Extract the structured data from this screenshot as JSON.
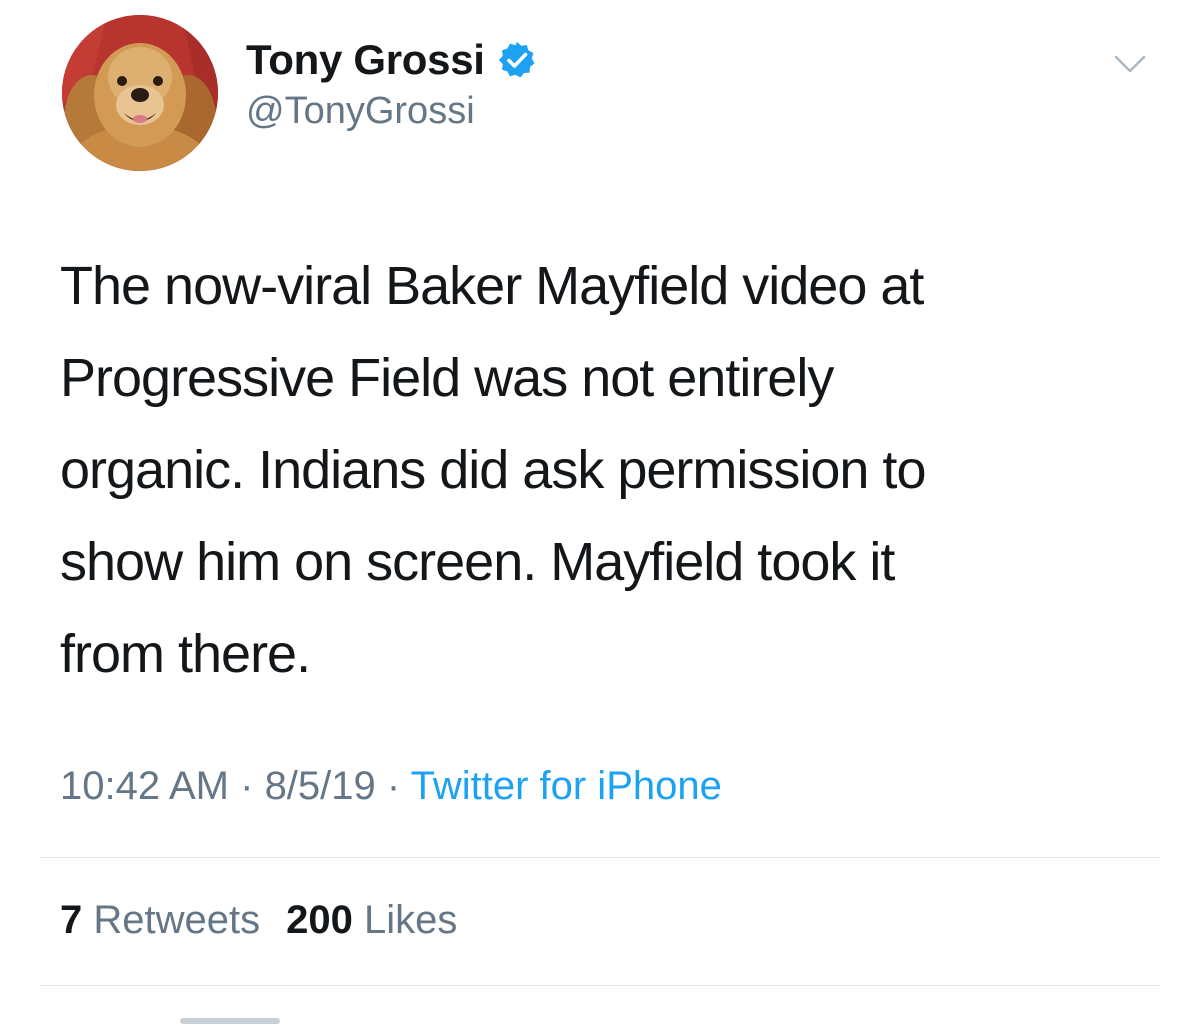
{
  "author": {
    "display_name": "Tony Grossi",
    "handle": "@TonyGrossi",
    "verified": true,
    "avatar_icon": "golden-retriever-avatar"
  },
  "tweet": {
    "text": "The now-viral Baker Mayfield video at\nProgressive Field was not entirely\norganic. Indians did ask permission to\nshow him on screen. Mayfield took it\nfrom there."
  },
  "meta": {
    "time": "10:42 AM",
    "separator": " · ",
    "date": "8/5/19",
    "source": "Twitter for iPhone"
  },
  "stats": {
    "retweets_count": "7",
    "retweets_label": " Retweets",
    "likes_count": "200",
    "likes_label": " Likes"
  },
  "icons": {
    "caret": "chevron-down-icon",
    "verified": "verified-badge-icon"
  },
  "colors": {
    "text_primary": "#14171a",
    "text_secondary": "#657786",
    "accent": "#1da1f2",
    "divider": "#e1e8ed"
  }
}
